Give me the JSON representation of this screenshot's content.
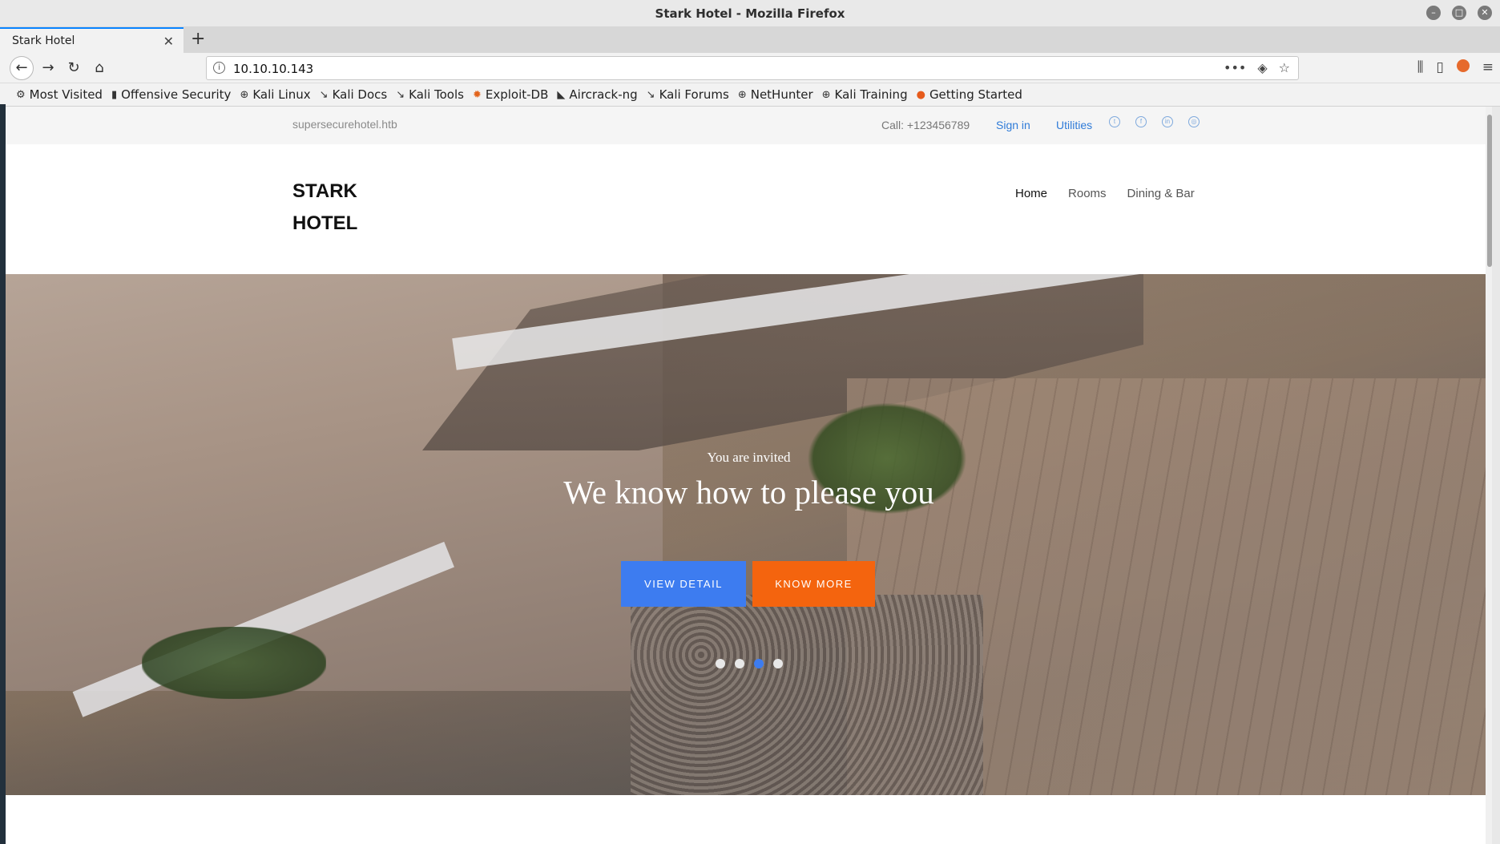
{
  "window": {
    "title": "Stark Hotel - Mozilla Firefox"
  },
  "tabs": [
    {
      "label": "Stark Hotel"
    }
  ],
  "navbar": {
    "url": "10.10.10.143"
  },
  "bookmarks": [
    {
      "label": "Most Visited",
      "icon": "gear-icon"
    },
    {
      "label": "Offensive Security",
      "icon": "offsec-icon"
    },
    {
      "label": "Kali Linux",
      "icon": "globe-icon"
    },
    {
      "label": "Kali Docs",
      "icon": "kali-icon"
    },
    {
      "label": "Kali Tools",
      "icon": "kali-icon"
    },
    {
      "label": "Exploit-DB",
      "icon": "exploitdb-icon"
    },
    {
      "label": "Aircrack-ng",
      "icon": "aircrack-icon"
    },
    {
      "label": "Kali Forums",
      "icon": "kali-icon"
    },
    {
      "label": "NetHunter",
      "icon": "globe-icon"
    },
    {
      "label": "Kali Training",
      "icon": "globe-icon"
    },
    {
      "label": "Getting Started",
      "icon": "firefox-icon"
    }
  ],
  "site": {
    "topbar": {
      "domain": "supersecurehotel.htb",
      "call": "Call: +123456789",
      "signin": "Sign in",
      "utilities": "Utilities",
      "social": [
        "twitter-icon",
        "facebook-icon",
        "linkedin-icon",
        "instagram-icon"
      ]
    },
    "logo": {
      "line1": "STARK",
      "line2": "HOTEL"
    },
    "nav": [
      "Home",
      "Rooms",
      "Dining & Bar"
    ],
    "hero": {
      "subtitle": "You are invited",
      "title": "We know how to please you",
      "btn_primary": "VIEW DETAIL",
      "btn_secondary": "KNOW MORE",
      "slides": 4,
      "active_slide": 3
    },
    "colors": {
      "primary": "#3d7cf0",
      "secondary": "#f4640e",
      "link": "#2f7bd8"
    }
  }
}
